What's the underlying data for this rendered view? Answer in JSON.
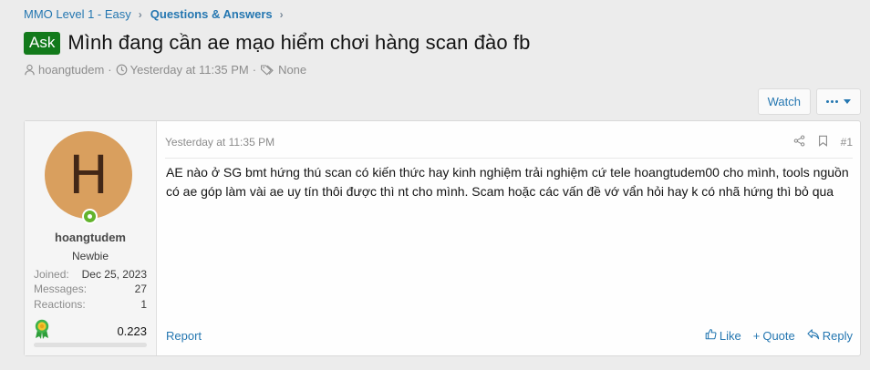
{
  "breadcrumb": {
    "items": [
      "MMO Level 1 - Easy",
      "Questions & Answers"
    ]
  },
  "thread": {
    "prefix": "Ask",
    "title": "Mình đang cần ae mạo hiểm chơi hàng scan đào fb",
    "author": "hoangtudem",
    "date": "Yesterday at 11:35 PM",
    "tags": "None"
  },
  "actions": {
    "watch": "Watch"
  },
  "post": {
    "user": {
      "avatar_letter": "H",
      "name": "hoangtudem",
      "title": "Newbie",
      "stats": [
        {
          "key": "Joined:",
          "value": "Dec 25, 2023"
        },
        {
          "key": "Messages:",
          "value": "27"
        },
        {
          "key": "Reactions:",
          "value": "1"
        }
      ],
      "trophy_points": "0.223",
      "progress": 0.0
    },
    "date": "Yesterday at 11:35 PM",
    "number": "#1",
    "body": "AE nào ở SG bmt hứng thú scan có kiến thức hay kinh nghiệm trải nghiệm cứ tele hoangtudem00 cho mình, tools nguồn có ae góp làm vài ae uy tín thôi được thì nt cho mình. Scam hoặc các vấn đề vớ vẩn hỏi hay k có nhã hứng thì bỏ qua",
    "footer": {
      "report": "Report",
      "like": "Like",
      "quote": "Quote",
      "reply": "Reply"
    }
  }
}
